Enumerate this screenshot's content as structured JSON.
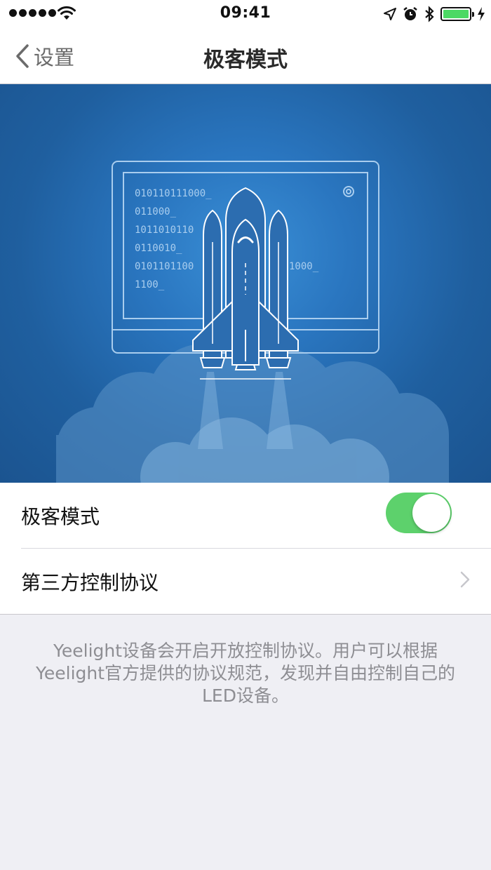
{
  "status_bar": {
    "time": "09:41",
    "battery_color": "#4cd964",
    "icons": [
      "signal-dots-icon",
      "wifi-icon",
      "location-icon",
      "alarm-icon",
      "bluetooth-icon",
      "battery-icon",
      "charging-icon"
    ]
  },
  "nav": {
    "back_label": "设置",
    "title": "极客模式"
  },
  "hero": {
    "code_lines": [
      "010110111000_",
      "011000_",
      "1011010110",
      "0110010_",
      "0101101100",
      "1000_",
      "1100_"
    ]
  },
  "settings": {
    "geek_mode_label": "极客模式",
    "geek_mode_enabled": true,
    "protocol_label": "第三方控制协议"
  },
  "footer": {
    "note": "Yeelight设备会开启开放控制协议。用户可以根据Yeelight官方提供的协议规范，发现并自由控制自己的LED设备。"
  },
  "colors": {
    "accent_green": "#5dd16c",
    "hero_blue": "#2a76c0"
  }
}
